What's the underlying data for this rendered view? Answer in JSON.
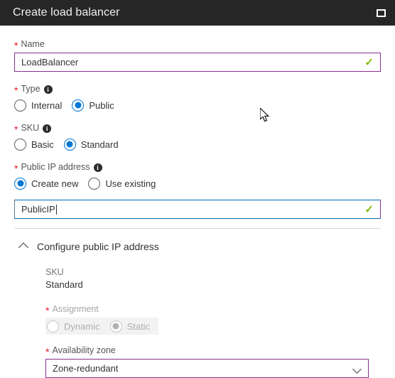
{
  "window": {
    "title": "Create load balancer",
    "restore_icon": "restore-window-icon"
  },
  "form": {
    "name": {
      "label": "Name",
      "required_mark": "*",
      "value": "LoadBalancer",
      "valid_icon": "✓"
    },
    "type": {
      "label": "Type",
      "required_mark": "*",
      "info_icon": "i",
      "options": [
        {
          "label": "Internal",
          "selected": false
        },
        {
          "label": "Public",
          "selected": true
        }
      ]
    },
    "sku": {
      "label": "SKU",
      "required_mark": "*",
      "info_icon": "i",
      "options": [
        {
          "label": "Basic",
          "selected": false
        },
        {
          "label": "Standard",
          "selected": true
        }
      ]
    },
    "public_ip_address": {
      "label": "Public IP address",
      "required_mark": "*",
      "info_icon": "i",
      "options": [
        {
          "label": "Create new",
          "selected": true
        },
        {
          "label": "Use existing",
          "selected": false
        }
      ],
      "name_value": "PublicIP",
      "valid_icon": "✓"
    },
    "configure_section": {
      "title": "Configure public IP address",
      "expanded": true,
      "sku": {
        "label": "SKU",
        "value": "Standard"
      },
      "assignment": {
        "label": "Assignment",
        "required_mark": "*",
        "disabled": true,
        "options": [
          {
            "label": "Dynamic",
            "selected": false
          },
          {
            "label": "Static",
            "selected": true
          }
        ]
      },
      "availability_zone": {
        "label": "Availability zone",
        "required_mark": "*",
        "value": "Zone-redundant"
      }
    }
  },
  "colors": {
    "titlebar_bg": "#262626",
    "accent_blue": "#0078d4",
    "focus_purple": "#86308f",
    "required_red": "#e81123",
    "valid_green": "#7fba00"
  }
}
